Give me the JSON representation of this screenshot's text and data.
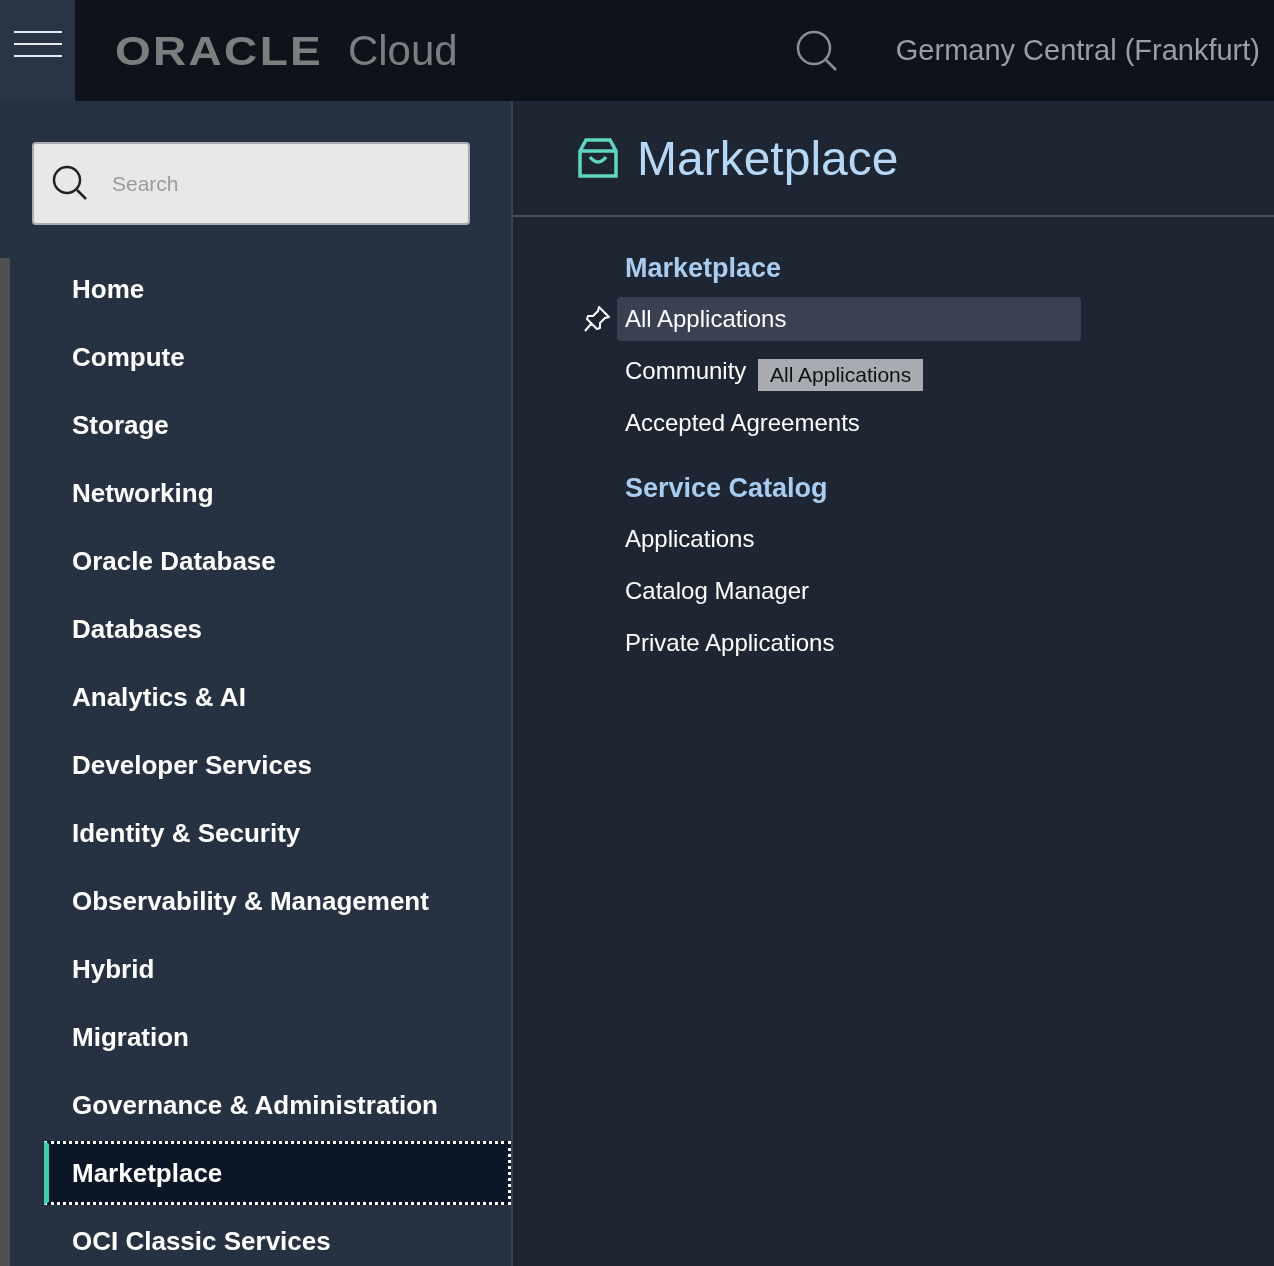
{
  "header": {
    "logo": "ORACLE",
    "product": "Cloud",
    "region": "Germany Central (Frankfurt)"
  },
  "sidebar": {
    "search": {
      "placeholder": "Search"
    },
    "items": [
      {
        "label": "Home",
        "selected": false
      },
      {
        "label": "Compute",
        "selected": false
      },
      {
        "label": "Storage",
        "selected": false
      },
      {
        "label": "Networking",
        "selected": false
      },
      {
        "label": "Oracle Database",
        "selected": false
      },
      {
        "label": "Databases",
        "selected": false
      },
      {
        "label": "Analytics & AI",
        "selected": false
      },
      {
        "label": "Developer Services",
        "selected": false
      },
      {
        "label": "Identity & Security",
        "selected": false
      },
      {
        "label": "Observability & Management",
        "selected": false
      },
      {
        "label": "Hybrid",
        "selected": false
      },
      {
        "label": "Migration",
        "selected": false
      },
      {
        "label": "Governance & Administration",
        "selected": false
      },
      {
        "label": "Marketplace",
        "selected": true
      },
      {
        "label": "OCI Classic Services",
        "selected": false
      }
    ]
  },
  "page": {
    "title": "Marketplace",
    "groups": [
      {
        "title": "Marketplace",
        "items": [
          {
            "label": "All Applications",
            "selected": true,
            "pinned": true
          },
          {
            "label": "Community",
            "selected": false,
            "pinned": false
          },
          {
            "label": "Accepted Agreements",
            "selected": false,
            "pinned": false
          }
        ]
      },
      {
        "title": "Service Catalog",
        "items": [
          {
            "label": "Applications",
            "selected": false,
            "pinned": false
          },
          {
            "label": "Catalog Manager",
            "selected": false,
            "pinned": false
          },
          {
            "label": "Private Applications",
            "selected": false,
            "pinned": false
          }
        ]
      }
    ]
  },
  "tooltip": {
    "text": "All Applications"
  }
}
